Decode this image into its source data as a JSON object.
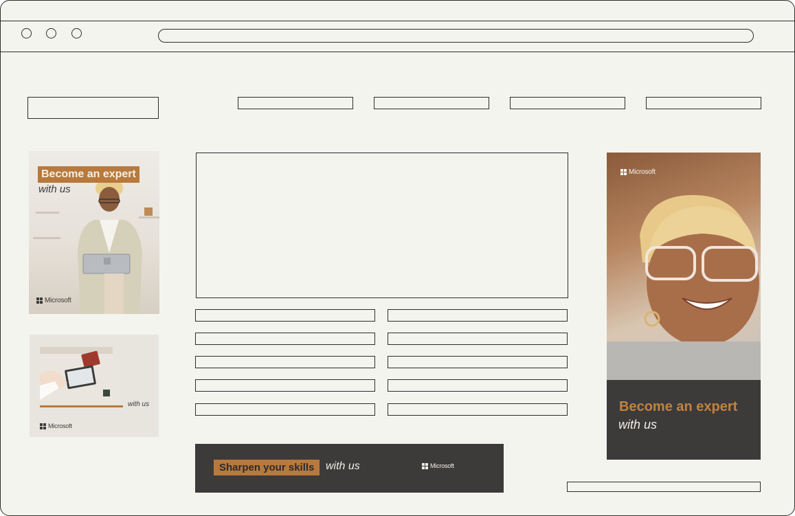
{
  "browser": {
    "window_controls": [
      "close",
      "minimize",
      "maximize"
    ]
  },
  "ads": {
    "left_tall": {
      "headline": "Become an expert",
      "subline": "with us",
      "brand": "Microsoft"
    },
    "left_square": {
      "subline": "with us",
      "brand": "Microsoft"
    },
    "right_tall": {
      "brand_top": "Microsoft",
      "headline": "Become an expert",
      "subline": "with us"
    },
    "bottom_banner": {
      "headline": "Sharpen your skills",
      "subline": "with us",
      "brand": "Microsoft"
    }
  },
  "colors": {
    "page_bg": "#f4f4ef",
    "outline": "#2b2b2b",
    "accent_orange": "#b8793d",
    "dark_panel": "#3d3a3a"
  }
}
